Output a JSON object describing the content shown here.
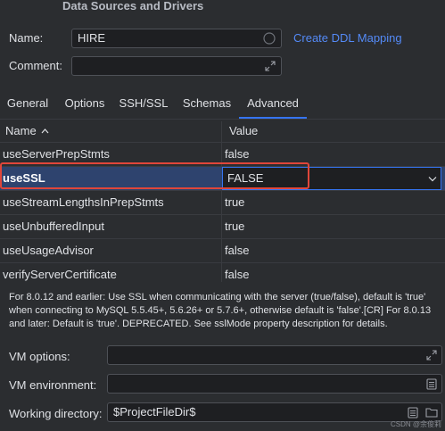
{
  "dialog": {
    "title": "Data Sources and Drivers"
  },
  "name_field": {
    "label": "Name:",
    "value": "HIRE"
  },
  "comment_field": {
    "label": "Comment:",
    "value": ""
  },
  "create_ddl_link": "Create DDL Mapping",
  "tabs": [
    {
      "label": "General",
      "active": false
    },
    {
      "label": "Options",
      "active": false
    },
    {
      "label": "SSH/SSL",
      "active": false
    },
    {
      "label": "Schemas",
      "active": false
    },
    {
      "label": "Advanced",
      "active": true
    }
  ],
  "table": {
    "columns": {
      "name": "Name",
      "value": "Value"
    },
    "rows": [
      {
        "name": "useServerPrepStmts",
        "value": "false"
      },
      {
        "name": "useSSL",
        "value": "FALSE",
        "selected": true
      },
      {
        "name": "useStreamLengthsInPrepStmts",
        "value": "true"
      },
      {
        "name": "useUnbufferedInput",
        "value": "true"
      },
      {
        "name": "useUsageAdvisor",
        "value": "false"
      },
      {
        "name": "verifyServerCertificate",
        "value": "false"
      }
    ]
  },
  "description": "For 8.0.12 and earlier: Use SSL when communicating with the server (true/false), default is 'true' when connecting to MySQL 5.5.45+, 5.6.26+ or 5.7.6+, otherwise default is 'false'.[CR] For 8.0.13 and later: Default is 'true'. DEPRECATED. See sslMode property description for details.",
  "vm_options": {
    "label": "VM options:",
    "value": ""
  },
  "vm_environment": {
    "label": "VM environment:",
    "value": ""
  },
  "working_directory": {
    "label": "Working directory:",
    "value": "$ProjectFileDir$"
  },
  "watermark": "CSDN @余俊莉",
  "colors": {
    "accent": "#3574f0",
    "highlight_border": "#e0463a",
    "link": "#548af7",
    "selection": "#2e436e"
  }
}
